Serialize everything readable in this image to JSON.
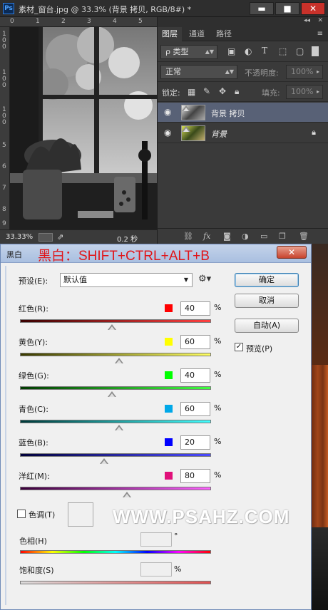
{
  "app": {
    "logo": "Ps",
    "doc_title": "素材_窗台.jpg @ 33.3% (背景 拷贝, RGB/8#) *",
    "window_buttons": {
      "minimize": "▬",
      "maximize": "■",
      "close": "✕"
    }
  },
  "rulers": {
    "h_ticks": [
      "0",
      "1",
      "2",
      "3",
      "4",
      "5"
    ],
    "v_ticks": [
      "1\n0\n0",
      "1\n0\n0",
      "1\n0\n0",
      "5",
      "6",
      "7",
      "8",
      "9"
    ]
  },
  "status": {
    "zoom": "33.33%",
    "time": "0.2 秒"
  },
  "layers_panel": {
    "top_arrows": "◂◂",
    "top_close": "✕",
    "tabs": [
      "图层",
      "通道",
      "路径"
    ],
    "filter_kind": "ρ 类型",
    "blend_mode": "正常",
    "opacity_label": "不透明度:",
    "opacity_value": "100%",
    "lock_label": "锁定:",
    "fill_label": "填充:",
    "fill_value": "100%",
    "layers": [
      {
        "name": "背景 拷贝",
        "selected": true,
        "locked": false
      },
      {
        "name": "背景",
        "selected": false,
        "locked": true
      }
    ]
  },
  "dialog": {
    "title": "黑白",
    "shortcut_annotation": "黑白：SHIFT+CTRL+ALT+B",
    "close_glyph": "✕",
    "preset_label": "预设(E):",
    "preset_value": "默认值",
    "buttons": {
      "ok": "确定",
      "cancel": "取消",
      "auto": "自动(A)"
    },
    "preview_label": "预览(P)",
    "preview_checked": true,
    "channels": [
      {
        "label": "红色(R):",
        "value": "40",
        "pct": 40,
        "swatch": "#ff0000",
        "gradient": [
          "#3a0000",
          "#ff4040"
        ]
      },
      {
        "label": "黄色(Y):",
        "value": "60",
        "pct": 60,
        "swatch": "#ffff00",
        "gradient": [
          "#3a3a00",
          "#ffff60"
        ]
      },
      {
        "label": "绿色(G):",
        "value": "40",
        "pct": 40,
        "swatch": "#00ff00",
        "gradient": [
          "#003a00",
          "#40ff40"
        ]
      },
      {
        "label": "青色(C):",
        "value": "60",
        "pct": 60,
        "swatch": "#00a8e8",
        "gradient": [
          "#003a3a",
          "#40ffff"
        ]
      },
      {
        "label": "蓝色(B):",
        "value": "20",
        "pct": 20,
        "swatch": "#0000ff",
        "gradient": [
          "#00003a",
          "#4a4aff"
        ]
      },
      {
        "label": "洋红(M):",
        "value": "80",
        "pct": 80,
        "swatch": "#e0107a",
        "gradient": [
          "#3a003a",
          "#ff60ff"
        ]
      }
    ],
    "tint_label": "色调(T)",
    "tint_checked": false,
    "hue_label": "色相(H)",
    "hue_unit": "°",
    "saturation_label": "饱和度(S)",
    "saturation_unit": "%",
    "pct_unit": "%"
  },
  "watermark": "WWW.PSAHZ.COM"
}
